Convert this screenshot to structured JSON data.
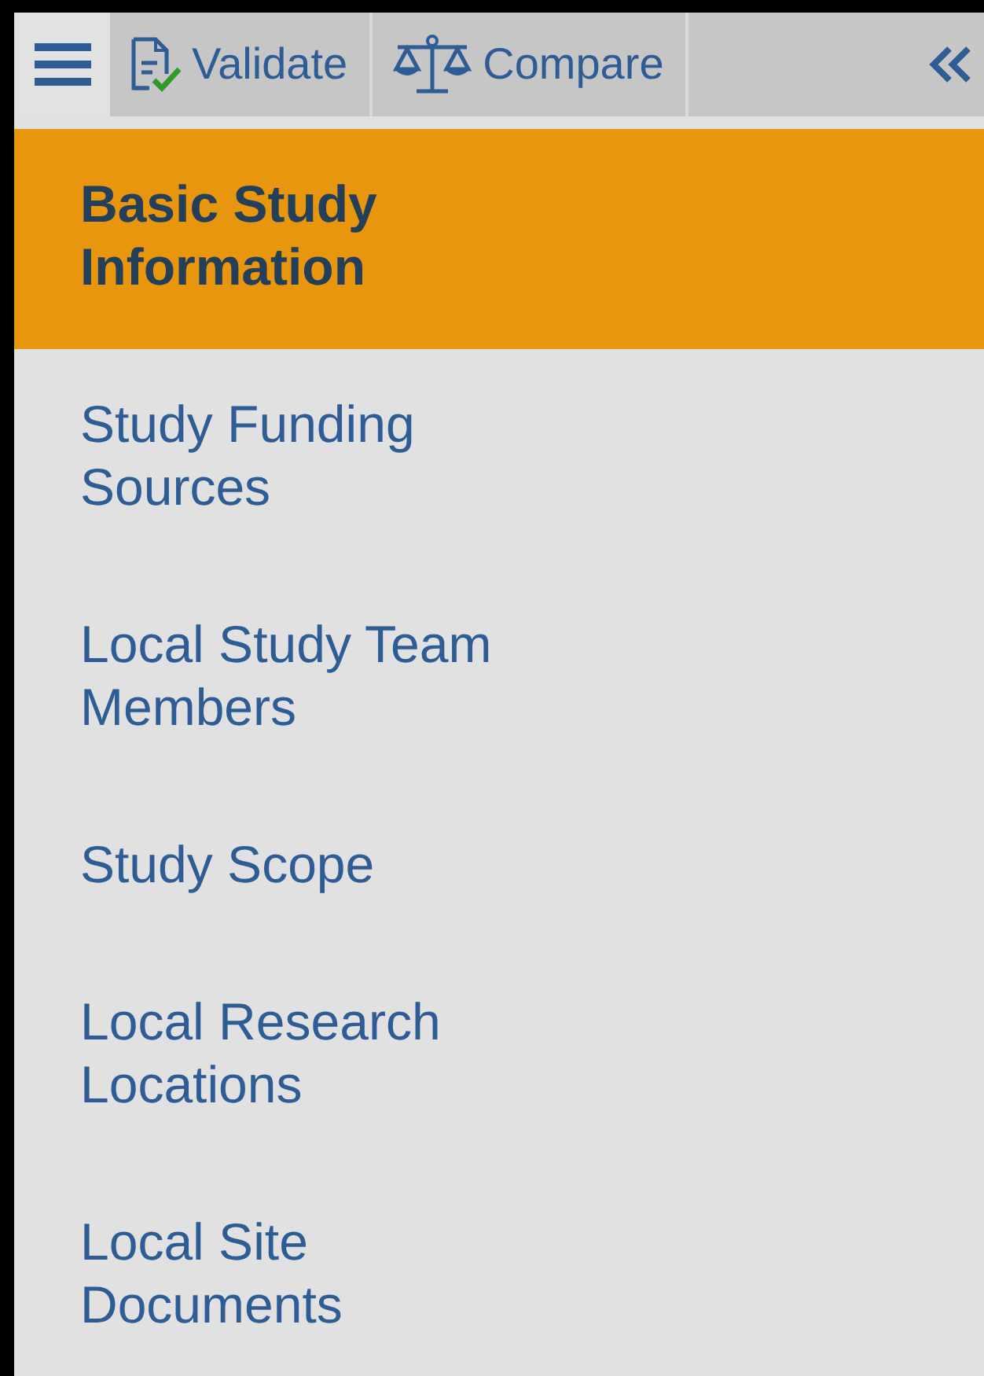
{
  "toolbar": {
    "buttons": [
      {
        "kind": "validate",
        "label": "Validate"
      },
      {
        "kind": "compare",
        "label": "Compare"
      }
    ]
  },
  "nav": {
    "items": [
      {
        "label": "Basic Study Information",
        "selected": true
      },
      {
        "label": "Study Funding Sources",
        "selected": false
      },
      {
        "label": "Local Study Team Members",
        "selected": false
      },
      {
        "label": "Study Scope",
        "selected": false
      },
      {
        "label": "Local Research Locations",
        "selected": false
      },
      {
        "label": "Local Site Documents",
        "selected": false
      }
    ]
  }
}
